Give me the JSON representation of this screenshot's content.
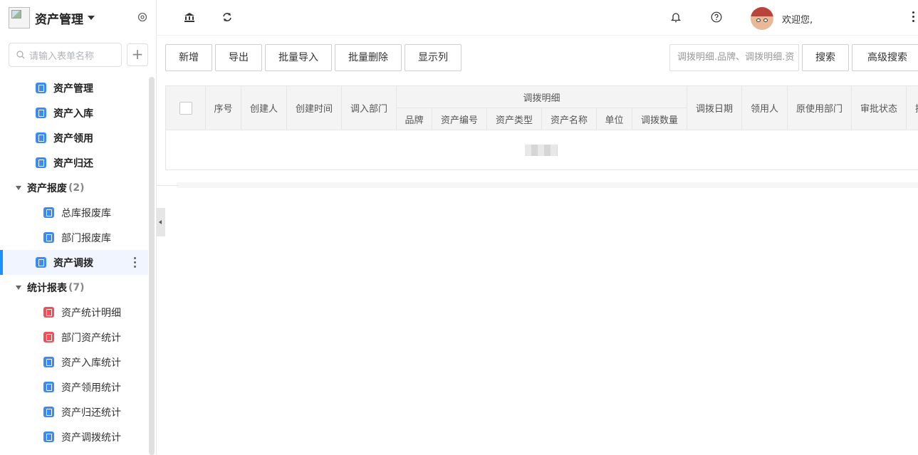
{
  "sidebar": {
    "title": "资产管理",
    "search_placeholder": "请输入表单名称",
    "add_label": "+",
    "items": [
      {
        "label": "资产管理",
        "level": 1,
        "icon": "form-icon",
        "icon_color": "#3d8bf2"
      },
      {
        "label": "资产入库",
        "level": 1,
        "icon": "form-icon",
        "icon_color": "#3d8bf2"
      },
      {
        "label": "资产领用",
        "level": 1,
        "icon": "form-icon",
        "icon_color": "#3d8bf2"
      },
      {
        "label": "资产归还",
        "level": 1,
        "icon": "form-icon",
        "icon_color": "#3d8bf2"
      },
      {
        "label": "资产报废",
        "count": "(2)",
        "group": true
      },
      {
        "label": "总库报废库",
        "level": 2,
        "icon": "form-icon",
        "icon_color": "#3d8bf2"
      },
      {
        "label": "部门报废库",
        "level": 2,
        "icon": "form-icon",
        "icon_color": "#3d8bf2"
      },
      {
        "label": "资产调拨",
        "level": 1,
        "active": true,
        "icon": "form-icon",
        "icon_color": "#3d8bf2"
      },
      {
        "label": "统计报表",
        "count": "(7)",
        "group": true
      },
      {
        "label": "资产统计明细",
        "level": 2,
        "icon": "report-icon",
        "icon_color": "#f0505a"
      },
      {
        "label": "部门资产统计",
        "level": 2,
        "icon": "report-icon",
        "icon_color": "#f0505a"
      },
      {
        "label": "资产入库统计",
        "level": 2,
        "icon": "form-icon",
        "icon_color": "#3d8bf2"
      },
      {
        "label": "资产领用统计",
        "level": 2,
        "icon": "form-icon",
        "icon_color": "#3d8bf2"
      },
      {
        "label": "资产归还统计",
        "level": 2,
        "icon": "form-icon",
        "icon_color": "#3d8bf2"
      },
      {
        "label": "资产调拨统计",
        "level": 2,
        "icon": "form-icon",
        "icon_color": "#3d8bf2"
      }
    ]
  },
  "topbar": {
    "welcome": "欢迎您,"
  },
  "toolbar": {
    "add": "新增",
    "export": "导出",
    "batch_import": "批量导入",
    "batch_delete": "批量删除",
    "show_columns": "显示列",
    "search_placeholder": "调拨明细.品牌、调拨明细.资",
    "search": "搜索",
    "advanced_search": "高级搜索"
  },
  "table": {
    "headers": {
      "index": "序号",
      "creator": "创建人",
      "created_time": "创建时间",
      "in_dept": "调入部门",
      "detail_group": "调拨明细",
      "brand": "品牌",
      "asset_no": "资产编号",
      "asset_type": "资产类型",
      "asset_name": "资产名称",
      "unit": "单位",
      "qty": "调拨数量",
      "transfer_date": "调拨日期",
      "receiver": "领用人",
      "orig_dept": "原使用部门",
      "approval": "审批状态",
      "extra": "提"
    }
  },
  "colors": {
    "accent": "#1890ff",
    "blue_icon": "#3d8bf2",
    "red_icon": "#f0505a"
  }
}
